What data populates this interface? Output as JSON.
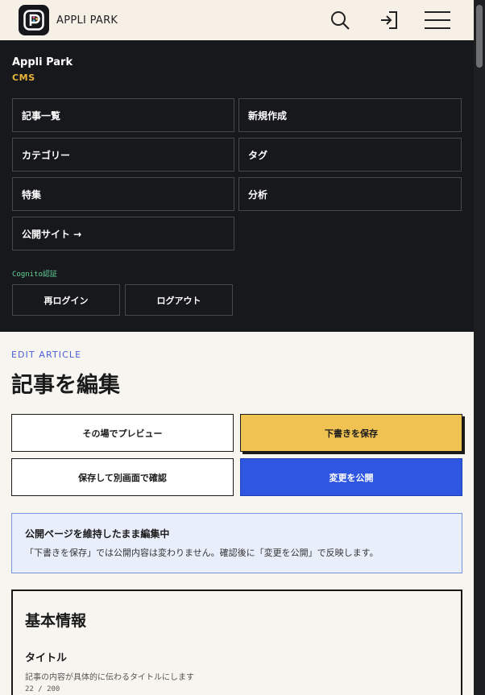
{
  "header": {
    "brand": "APPLI PARK",
    "icons": [
      "app-logo-icon",
      "search-icon",
      "login-icon",
      "menu-icon"
    ]
  },
  "cms": {
    "title": "Appli Park",
    "subtitle": "CMS",
    "nav": [
      "記事一覧",
      "新規作成",
      "カテゴリー",
      "タグ",
      "特集",
      "分析",
      "公開サイト →"
    ],
    "auth_label": "Cognito認証",
    "relogin": "再ログイン",
    "logout": "ログアウト"
  },
  "main": {
    "eyebrow": "EDIT ARTICLE",
    "title": "記事を編集",
    "actions": {
      "preview": "その場でプレビュー",
      "save_draft": "下書きを保存",
      "save_open": "保存して別画面で確認",
      "publish": "変更を公開"
    },
    "notice": {
      "title": "公開ページを維持したまま編集中",
      "body": "「下書きを保存」では公開内容は変わりません。確認後に「変更を公開」で反映します。"
    },
    "card": {
      "title": "基本情報",
      "field_label": "タイトル",
      "field_help": "記事の内容が具体的に伝わるタイトルにします",
      "count": "22 / 200"
    }
  },
  "colors": {
    "accent_yellow": "#f0c252",
    "accent_blue": "#2f56e0",
    "cms_bg": "#17181b",
    "brand_gold": "#e6b53a",
    "auth_green": "#63d49a"
  }
}
